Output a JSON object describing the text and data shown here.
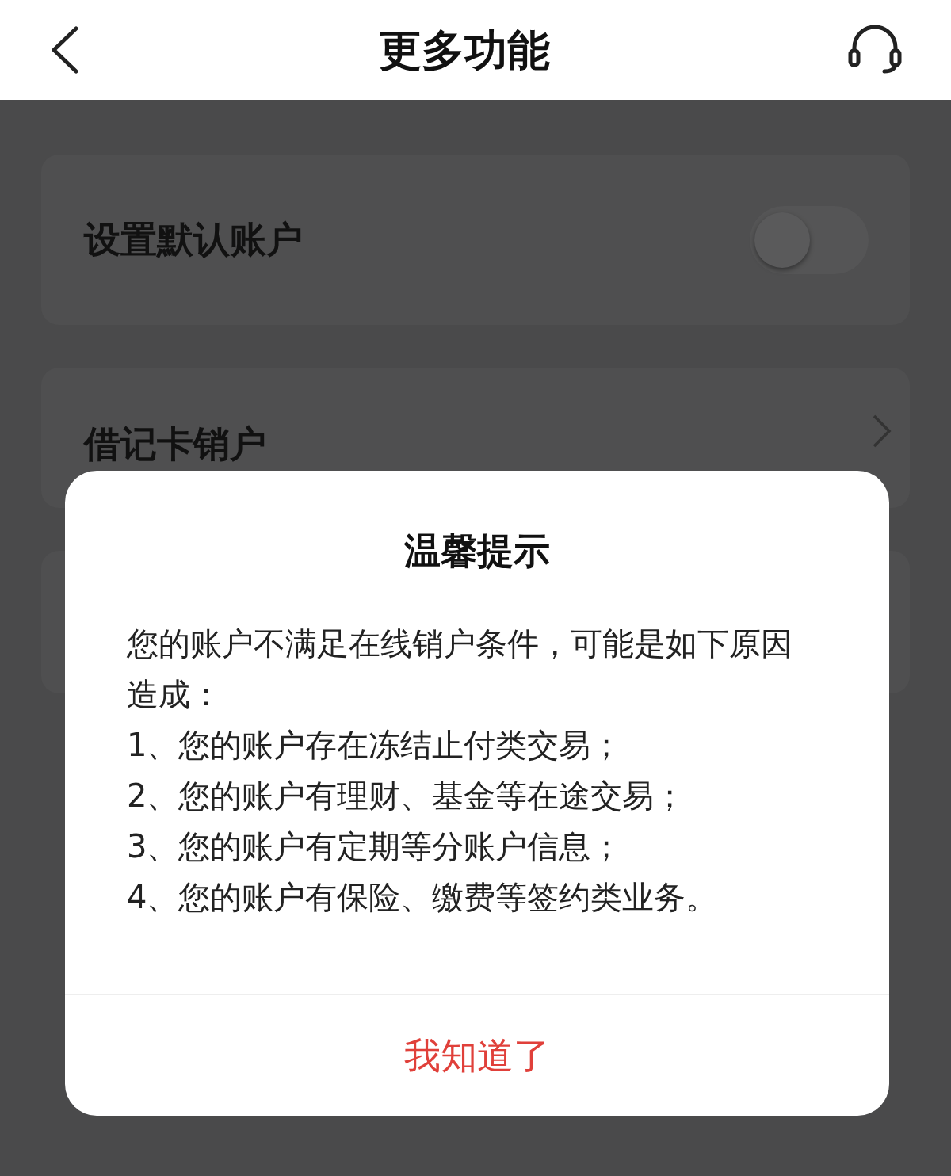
{
  "header": {
    "title": "更多功能"
  },
  "settings": [
    {
      "kind": "toggle",
      "label": "设置默认账户",
      "on": false
    },
    {
      "kind": "link",
      "label": "借记卡销户"
    }
  ],
  "dialog": {
    "title": "温馨提示",
    "lines": [
      "您的账户不满足在线销户条件，可能是如下原因造成：",
      "1、您的账户存在冻结止付类交易；",
      "2、您的账户有理财、基金等在途交易；",
      "3、您的账户有定期等分账户信息；",
      "4、您的账户有保险、缴费等签约类业务。"
    ],
    "button": "我知道了"
  }
}
